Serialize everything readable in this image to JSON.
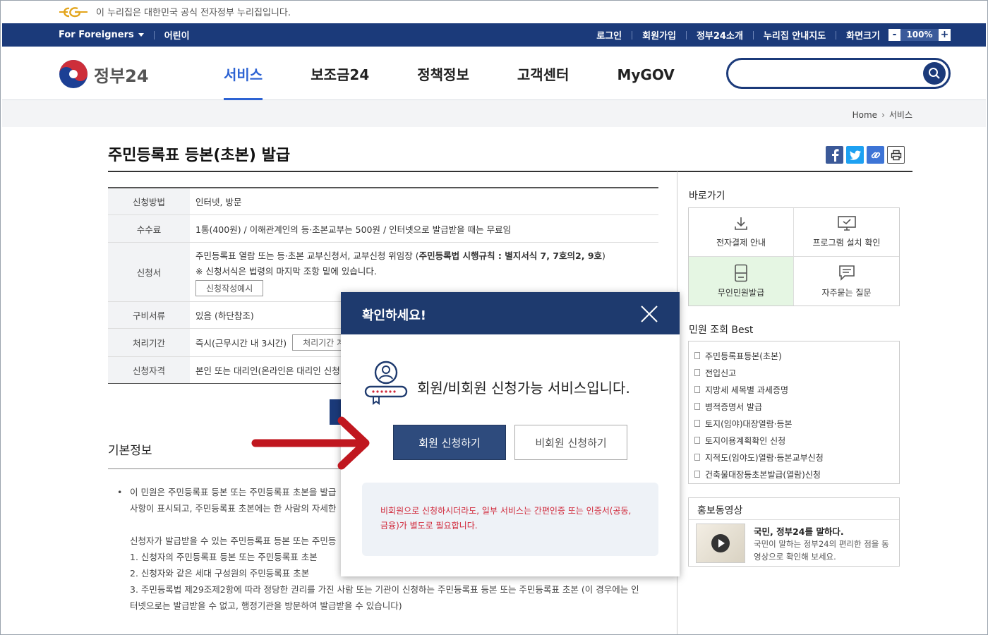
{
  "gov_banner": {
    "text": "이 누리집은 대한민국 공식 전자정부 누리집입니다."
  },
  "util_bar": {
    "left": [
      "For Foreigners",
      "어린이"
    ],
    "right": [
      "로그인",
      "회원가입",
      "정부24소개",
      "누리집 안내지도",
      "화면크기"
    ],
    "zoom_minus": "-",
    "zoom_value": "100%",
    "zoom_plus": "+"
  },
  "header": {
    "logo_text": "정부24",
    "nav": [
      "서비스",
      "보조금24",
      "정책정보",
      "고객센터",
      "MyGOV"
    ],
    "active_nav": "서비스",
    "search_placeholder": ""
  },
  "breadcrumb": {
    "home": "Home",
    "current": "서비스"
  },
  "page": {
    "title": "주민등록표 등본(초본) 발급"
  },
  "info_table": {
    "method": {
      "label": "신청방법",
      "value": "인터넷, 방문"
    },
    "fee": {
      "label": "수수료",
      "value": "1통(400원) / 이해관계인의 등·초본교부는 500원 / 인터넷으로 발급받을 때는 무료임"
    },
    "form": {
      "label": "신청서",
      "line1": "주민등록표 열람 또는 등·초본 교부신청서, 교부신청 위임장 (",
      "line1_bold": "주민등록법 시행규칙 : 별지서식 7, 7호의2, 9호",
      "line1_end": ")",
      "line2": "※ 신청서식은 법령의 마지막 조항 밑에 있습니다.",
      "button": "신청작성예시"
    },
    "docs": {
      "label": "구비서류",
      "value": "있음 (하단참조)"
    },
    "period": {
      "label": "처리기간",
      "value": "즉시(근무시간 내 3시간)",
      "button": "처리기간 계"
    },
    "eligibility": {
      "label": "신청자격",
      "value": "본인 또는 대리인(온라인은 대리인 신청"
    }
  },
  "basic_info": {
    "title": "기본정보",
    "bullet_line1": "이 민원은 주민등록표 등본 또는 주민등록표 초본을 발급",
    "bullet_line2": "사항이 표시되고, 주민등록표 초본에는 한 사람의 자세한",
    "para1": "신청자가 발급받을 수 있는 주민등록표 등본 또는 주민등",
    "item1": "1. 신청자의 주민등록표 등본 또는 주민등록표 초본",
    "item2": "2. 신청자와 같은 세대 구성원의 주민등록표 초본",
    "item3a": "3. 주민등록법 제29조제2항에 따라 정당한 권리를 가진 사람 또는 기관이 신청하는 주민등록표 등본 또는 주민등록표 초본 (이 경우에는 인",
    "item3b": "터넷으로는 발급받을 수 없고, 행정기관을 방문하여 발급받을 수 있습니다)"
  },
  "sidebar": {
    "shortcut_title": "바로가기",
    "shortcuts": [
      {
        "label": "전자결제 안내",
        "icon": "download-icon"
      },
      {
        "label": "프로그램 설치 확인",
        "icon": "monitor-check-icon"
      },
      {
        "label": "무인민원발급",
        "icon": "kiosk-icon"
      },
      {
        "label": "자주묻는 질문",
        "icon": "chat-icon"
      }
    ],
    "best_title": "민원 조회 Best",
    "best_items": [
      "주민등록표등본(초본)",
      "전입신고",
      "지방세 세목별 과세증명",
      "병적증명서 발급",
      "토지(임야)대장열람·등본",
      "토지이용계획확인 신청",
      "지적도(임야도)열람·등본교부신청",
      "건축물대장등초본발급(열람)신청"
    ],
    "promo_title": "홍보동영상",
    "promo_headline": "국민, 정부24를 말하다.",
    "promo_desc": "국민이 말하는 정부24의 편리한 점을 동영상으로 확인해 보세요."
  },
  "modal": {
    "title": "확인하세요!",
    "message": "회원/비회원 신청가능 서비스입니다.",
    "member_button": "회원 신청하기",
    "guest_button": "비회원 신청하기",
    "notice": "비회원으로 신청하시더라도, 일부 서비스는 간편인증 또는 인증서(공동, 금융)가 별도로 필요합니다."
  },
  "colors": {
    "navy": "#1b3a7a",
    "active_blue": "#2d63d3",
    "modal_header": "#1e3a6e",
    "notice_red": "#d0283a",
    "annotation_arrow": "#c0171f"
  }
}
